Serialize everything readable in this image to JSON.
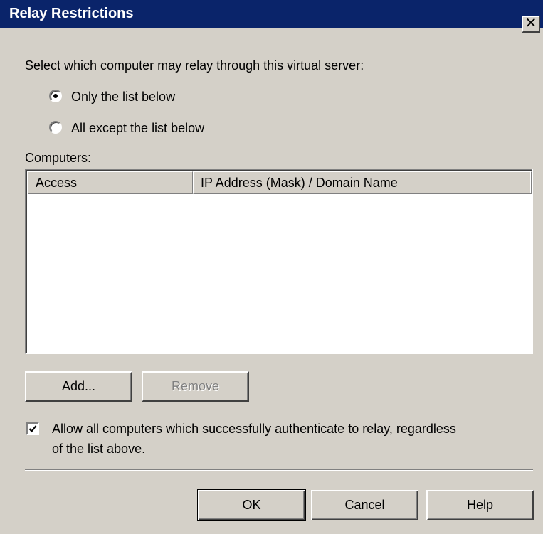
{
  "window": {
    "title": "Relay Restrictions",
    "close_symbol": "✕"
  },
  "prompt": "Select which computer may relay through this virtual server:",
  "options": {
    "only_list": {
      "label": "Only the list below",
      "checked": true
    },
    "all_except": {
      "label": "All except the list below",
      "checked": false
    }
  },
  "computers": {
    "label": "Computers:",
    "columns": [
      "Access",
      "IP Address (Mask) / Domain Name"
    ],
    "rows": []
  },
  "buttons": {
    "add": "Add...",
    "remove": "Remove",
    "ok": "OK",
    "cancel": "Cancel",
    "help": "Help"
  },
  "allow_auth": {
    "checked": true,
    "line1": "Allow all computers which successfully authenticate to relay, regardless",
    "line2": "of the list above."
  },
  "colors": {
    "titlebar": "#0a246a",
    "face": "#d4d0c8",
    "disabled_text": "#808080"
  }
}
